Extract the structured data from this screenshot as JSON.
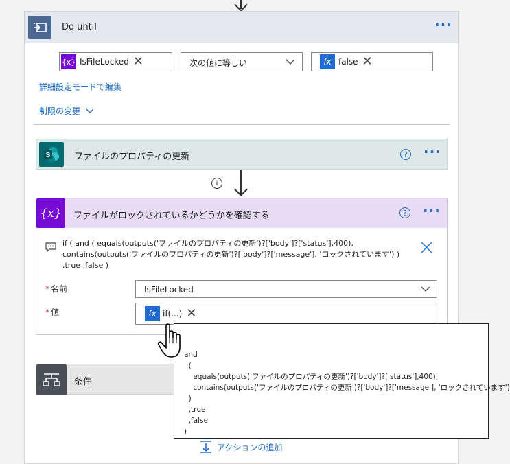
{
  "do_until": {
    "title": "Do until",
    "condition": {
      "left_token": "IsFileLocked",
      "operator": "次の値に等しい",
      "right_token": "false"
    },
    "advanced_link": "詳細設定モードで編集",
    "limits_link": "制限の変更"
  },
  "actions": {
    "sharepoint": {
      "title": "ファイルのプロパティの更新"
    },
    "set_variable": {
      "title": "ファイルがロックされているかどうかを確認する",
      "comment_lines": [
        "if ( and ( equals(outputs('ファイルのプロパティの更新')?['body']?['status'],400),",
        "contains(outputs('ファイルのプロパティの更新')?['body']?['message'], 'ロックされています') )",
        ",true ,false )"
      ],
      "name_label": "名前",
      "name_value": "IsFileLocked",
      "value_label": "値",
      "value_token": "if(...)"
    },
    "condition": {
      "title": "条件"
    }
  },
  "tooltip": {
    "lines": [
      "and",
      "  (",
      "    equals(outputs('ファイルのプロパティの更新')?['body']?['status'],400),",
      "    contains(outputs('ファイルのプロパティの更新')?['body']?['message'], 'ロックされています')",
      "  )",
      "  ,true",
      "  ,false",
      ")"
    ]
  },
  "add_action": "アクションの追加",
  "colors": {
    "accent": "#1f6cd1",
    "variable_purple": "#770bd6",
    "sharepoint_teal": "#036c70",
    "do_until_header": "#4a6892"
  }
}
